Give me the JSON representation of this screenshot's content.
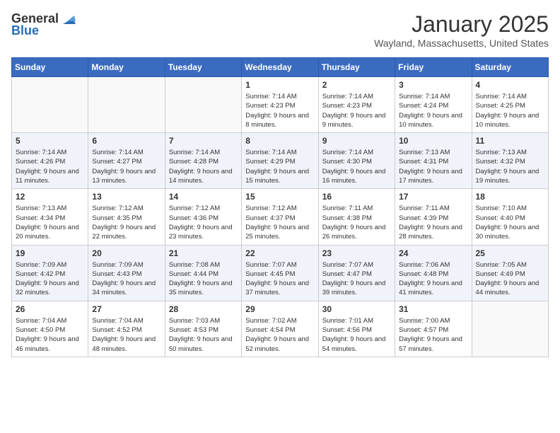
{
  "header": {
    "logo_general": "General",
    "logo_blue": "Blue",
    "month": "January 2025",
    "location": "Wayland, Massachusetts, United States"
  },
  "weekdays": [
    "Sunday",
    "Monday",
    "Tuesday",
    "Wednesday",
    "Thursday",
    "Friday",
    "Saturday"
  ],
  "weeks": [
    [
      {
        "day": "",
        "sunrise": "",
        "sunset": "",
        "daylight": ""
      },
      {
        "day": "",
        "sunrise": "",
        "sunset": "",
        "daylight": ""
      },
      {
        "day": "",
        "sunrise": "",
        "sunset": "",
        "daylight": ""
      },
      {
        "day": "1",
        "sunrise": "Sunrise: 7:14 AM",
        "sunset": "Sunset: 4:23 PM",
        "daylight": "Daylight: 9 hours and 8 minutes."
      },
      {
        "day": "2",
        "sunrise": "Sunrise: 7:14 AM",
        "sunset": "Sunset: 4:23 PM",
        "daylight": "Daylight: 9 hours and 9 minutes."
      },
      {
        "day": "3",
        "sunrise": "Sunrise: 7:14 AM",
        "sunset": "Sunset: 4:24 PM",
        "daylight": "Daylight: 9 hours and 10 minutes."
      },
      {
        "day": "4",
        "sunrise": "Sunrise: 7:14 AM",
        "sunset": "Sunset: 4:25 PM",
        "daylight": "Daylight: 9 hours and 10 minutes."
      }
    ],
    [
      {
        "day": "5",
        "sunrise": "Sunrise: 7:14 AM",
        "sunset": "Sunset: 4:26 PM",
        "daylight": "Daylight: 9 hours and 11 minutes."
      },
      {
        "day": "6",
        "sunrise": "Sunrise: 7:14 AM",
        "sunset": "Sunset: 4:27 PM",
        "daylight": "Daylight: 9 hours and 13 minutes."
      },
      {
        "day": "7",
        "sunrise": "Sunrise: 7:14 AM",
        "sunset": "Sunset: 4:28 PM",
        "daylight": "Daylight: 9 hours and 14 minutes."
      },
      {
        "day": "8",
        "sunrise": "Sunrise: 7:14 AM",
        "sunset": "Sunset: 4:29 PM",
        "daylight": "Daylight: 9 hours and 15 minutes."
      },
      {
        "day": "9",
        "sunrise": "Sunrise: 7:14 AM",
        "sunset": "Sunset: 4:30 PM",
        "daylight": "Daylight: 9 hours and 16 minutes."
      },
      {
        "day": "10",
        "sunrise": "Sunrise: 7:13 AM",
        "sunset": "Sunset: 4:31 PM",
        "daylight": "Daylight: 9 hours and 17 minutes."
      },
      {
        "day": "11",
        "sunrise": "Sunrise: 7:13 AM",
        "sunset": "Sunset: 4:32 PM",
        "daylight": "Daylight: 9 hours and 19 minutes."
      }
    ],
    [
      {
        "day": "12",
        "sunrise": "Sunrise: 7:13 AM",
        "sunset": "Sunset: 4:34 PM",
        "daylight": "Daylight: 9 hours and 20 minutes."
      },
      {
        "day": "13",
        "sunrise": "Sunrise: 7:12 AM",
        "sunset": "Sunset: 4:35 PM",
        "daylight": "Daylight: 9 hours and 22 minutes."
      },
      {
        "day": "14",
        "sunrise": "Sunrise: 7:12 AM",
        "sunset": "Sunset: 4:36 PM",
        "daylight": "Daylight: 9 hours and 23 minutes."
      },
      {
        "day": "15",
        "sunrise": "Sunrise: 7:12 AM",
        "sunset": "Sunset: 4:37 PM",
        "daylight": "Daylight: 9 hours and 25 minutes."
      },
      {
        "day": "16",
        "sunrise": "Sunrise: 7:11 AM",
        "sunset": "Sunset: 4:38 PM",
        "daylight": "Daylight: 9 hours and 26 minutes."
      },
      {
        "day": "17",
        "sunrise": "Sunrise: 7:11 AM",
        "sunset": "Sunset: 4:39 PM",
        "daylight": "Daylight: 9 hours and 28 minutes."
      },
      {
        "day": "18",
        "sunrise": "Sunrise: 7:10 AM",
        "sunset": "Sunset: 4:40 PM",
        "daylight": "Daylight: 9 hours and 30 minutes."
      }
    ],
    [
      {
        "day": "19",
        "sunrise": "Sunrise: 7:09 AM",
        "sunset": "Sunset: 4:42 PM",
        "daylight": "Daylight: 9 hours and 32 minutes."
      },
      {
        "day": "20",
        "sunrise": "Sunrise: 7:09 AM",
        "sunset": "Sunset: 4:43 PM",
        "daylight": "Daylight: 9 hours and 34 minutes."
      },
      {
        "day": "21",
        "sunrise": "Sunrise: 7:08 AM",
        "sunset": "Sunset: 4:44 PM",
        "daylight": "Daylight: 9 hours and 35 minutes."
      },
      {
        "day": "22",
        "sunrise": "Sunrise: 7:07 AM",
        "sunset": "Sunset: 4:45 PM",
        "daylight": "Daylight: 9 hours and 37 minutes."
      },
      {
        "day": "23",
        "sunrise": "Sunrise: 7:07 AM",
        "sunset": "Sunset: 4:47 PM",
        "daylight": "Daylight: 9 hours and 39 minutes."
      },
      {
        "day": "24",
        "sunrise": "Sunrise: 7:06 AM",
        "sunset": "Sunset: 4:48 PM",
        "daylight": "Daylight: 9 hours and 41 minutes."
      },
      {
        "day": "25",
        "sunrise": "Sunrise: 7:05 AM",
        "sunset": "Sunset: 4:49 PM",
        "daylight": "Daylight: 9 hours and 44 minutes."
      }
    ],
    [
      {
        "day": "26",
        "sunrise": "Sunrise: 7:04 AM",
        "sunset": "Sunset: 4:50 PM",
        "daylight": "Daylight: 9 hours and 46 minutes."
      },
      {
        "day": "27",
        "sunrise": "Sunrise: 7:04 AM",
        "sunset": "Sunset: 4:52 PM",
        "daylight": "Daylight: 9 hours and 48 minutes."
      },
      {
        "day": "28",
        "sunrise": "Sunrise: 7:03 AM",
        "sunset": "Sunset: 4:53 PM",
        "daylight": "Daylight: 9 hours and 50 minutes."
      },
      {
        "day": "29",
        "sunrise": "Sunrise: 7:02 AM",
        "sunset": "Sunset: 4:54 PM",
        "daylight": "Daylight: 9 hours and 52 minutes."
      },
      {
        "day": "30",
        "sunrise": "Sunrise: 7:01 AM",
        "sunset": "Sunset: 4:56 PM",
        "daylight": "Daylight: 9 hours and 54 minutes."
      },
      {
        "day": "31",
        "sunrise": "Sunrise: 7:00 AM",
        "sunset": "Sunset: 4:57 PM",
        "daylight": "Daylight: 9 hours and 57 minutes."
      },
      {
        "day": "",
        "sunrise": "",
        "sunset": "",
        "daylight": ""
      }
    ]
  ]
}
